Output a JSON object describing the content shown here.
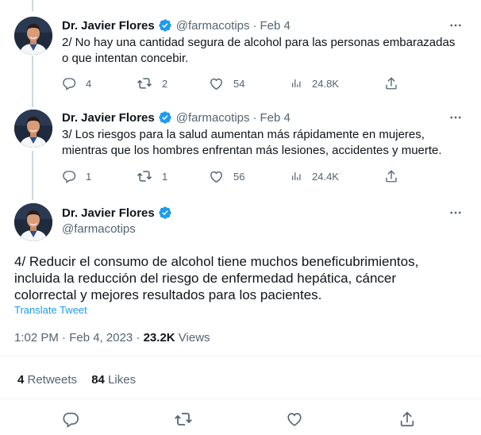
{
  "author": {
    "name": "Dr. Javier Flores",
    "handle": "@farmacotips"
  },
  "thread": [
    {
      "date": "Feb 4",
      "text_line1": "2/ No hay una cantidad segura de alcohol para las personas embarazadas",
      "text_line2": "o que intentan concebir.",
      "replies": "4",
      "retweets": "2",
      "likes": "54",
      "views": "24.8K"
    },
    {
      "date": "Feb 4",
      "text_line1": "3/ Los riesgos para la salud aumentan más rápidamente en mujeres,",
      "text_line2": "mientras que los hombres enfrentan más lesiones, accidentes y muerte.",
      "replies": "1",
      "retweets": "1",
      "likes": "56",
      "views": "24.4K"
    }
  ],
  "main_tweet": {
    "handle": "@farmacotips",
    "text_line1": "4/ Reducir el consumo de alcohol tiene muchos beneficubrimientos,",
    "text_line2": "incluida la reducción del riesgo de enfermedad hepática, cáncer",
    "text_line3": "colorrectal y mejores resultados para los pacientes.",
    "translate": "Translate Tweet",
    "time": "1:02 PM · Feb 4, 2023 · ",
    "views_count": "23.2K",
    "views_label": " Views",
    "retweets_count": "4",
    "retweets_label": " Retweets",
    "likes_count": "84",
    "likes_label": " Likes"
  },
  "colors": {
    "verified": "#1d9bf0",
    "secondary_text": "#536471",
    "link": "#1d9bf0"
  },
  "icons": [
    "more-icon",
    "reply-icon",
    "retweet-icon",
    "like-icon",
    "views-icon",
    "share-icon",
    "verified-badge-icon"
  ]
}
